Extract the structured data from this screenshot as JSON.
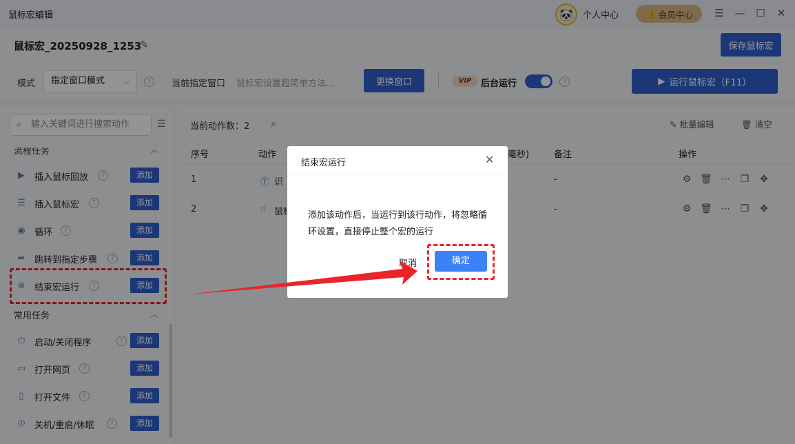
{
  "window": {
    "title": "鼠标宏编辑",
    "profile_label": "个人中心",
    "vip_label": "会员中心"
  },
  "header": {
    "macro_name": "鼠标宏_20250928_1253",
    "save_label": "保存鼠标宏"
  },
  "controls": {
    "mode_label": "模式",
    "mode_value": "指定窗口模式",
    "current_window_label": "当前指定窗口",
    "current_window_value": "鼠标宏设置超简单方法...",
    "switch_window_label": "更换窗口",
    "vip_badge": "VIP",
    "background_run_label": "后台运行",
    "background_run_on": true,
    "run_label": "运行鼠标宏（F11）"
  },
  "sidebar": {
    "search_placeholder": "输入关键词进行搜索动作",
    "sections": [
      {
        "title": "流程任务",
        "items": [
          {
            "label": "插入鼠标回放",
            "add": "添加"
          },
          {
            "label": "插入鼠标宏",
            "add": "添加"
          },
          {
            "label": "循环",
            "add": "添加"
          },
          {
            "label": "跳转到指定步骤",
            "add": "添加"
          },
          {
            "label": "结束宏运行",
            "add": "添加"
          }
        ]
      },
      {
        "title": "常用任务",
        "items": [
          {
            "label": "启动/关闭程序",
            "add": "添加"
          },
          {
            "label": "打开网页",
            "add": "添加"
          },
          {
            "label": "打开文件",
            "add": "添加"
          },
          {
            "label": "关机/重启/休眠",
            "add": "添加"
          }
        ]
      }
    ]
  },
  "main": {
    "action_count_label": "当前动作数：2",
    "batch_edit_label": "批量编辑",
    "clear_label": "清空",
    "columns": [
      "序号",
      "动作",
      "毫秒)",
      "备注",
      "操作"
    ],
    "rows": [
      {
        "index": "1",
        "action": "识",
        "note": "-"
      },
      {
        "index": "2",
        "action": "鼠标",
        "note": "-"
      }
    ]
  },
  "dialog": {
    "title": "结束宏运行",
    "message": "添加该动作后，当运行到该行动作，将忽略循环设置，直接停止整个宏的运行",
    "cancel_label": "取消",
    "ok_label": "确定"
  },
  "colors": {
    "primary": "#2f5fcf",
    "dialog_ok": "#3b82f6",
    "annotation_red": "#e8262a"
  }
}
